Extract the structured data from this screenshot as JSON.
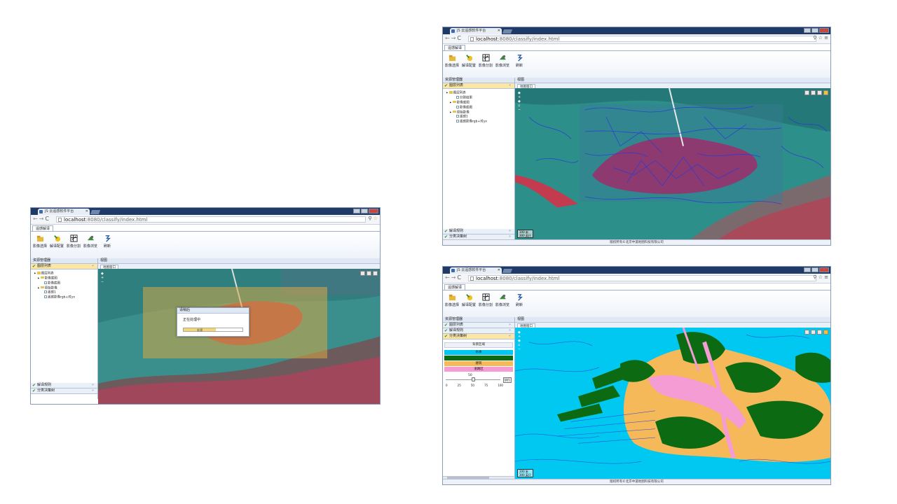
{
  "app": {
    "tab_title": "JS 云遥感软件平台",
    "url_host": "localhost",
    "url_path": ":8080/classify/index.html",
    "ribbon_tab": "遥感解译"
  },
  "toolbar": {
    "items": [
      "影像选择",
      "解译配置",
      "影像分割",
      "影像浏览",
      "刷新"
    ]
  },
  "left_panel": {
    "header": "资源管理器",
    "sections": {
      "layers": "图层列表",
      "rules": "解译规则",
      "classify": "分类决策树"
    },
    "tree": {
      "root": "图层列表",
      "group1": "分割结果",
      "group1_item": "分割结果",
      "group2": "影像底图",
      "group2_item": "影像底图",
      "group3": "原始影像",
      "group3_item1": "遥感1",
      "group3_item2": "遥感影像rgb+对yx"
    }
  },
  "right_panel": {
    "header": "视图",
    "tab": "地图窗口"
  },
  "progress_dialog": {
    "title": "请稍后",
    "message": "正在处理中",
    "bar_label": "处理",
    "percent": 55
  },
  "scale": {
    "top": "100 米",
    "bottom": "300 英尺"
  },
  "legend": {
    "title": "背景区域",
    "classes": [
      {
        "label": "水体",
        "color": "#00c8f0"
      },
      {
        "label": "",
        "color": "#0b6a12"
      },
      {
        "label": "建筑",
        "color": "#f5b95a"
      },
      {
        "label": "道路区",
        "color": "#f49cd3"
      }
    ]
  },
  "slider": {
    "value": "50",
    "value_fraction": 0.5,
    "exec_label": "执行",
    "ticks": [
      "0",
      "25",
      "50",
      "75",
      "100"
    ]
  },
  "footer": "版权所有©北京中遥地图科技有限公司",
  "colors": {
    "titlebar": "#1f3a66",
    "water": "#2d8f8a",
    "vegetation_red": "#b5384a",
    "segment_blue": "#2a3cd8",
    "class_water": "#00c8f0",
    "class_forest": "#0b6a12",
    "class_building": "#f5b95a",
    "class_road": "#f49cd3"
  }
}
